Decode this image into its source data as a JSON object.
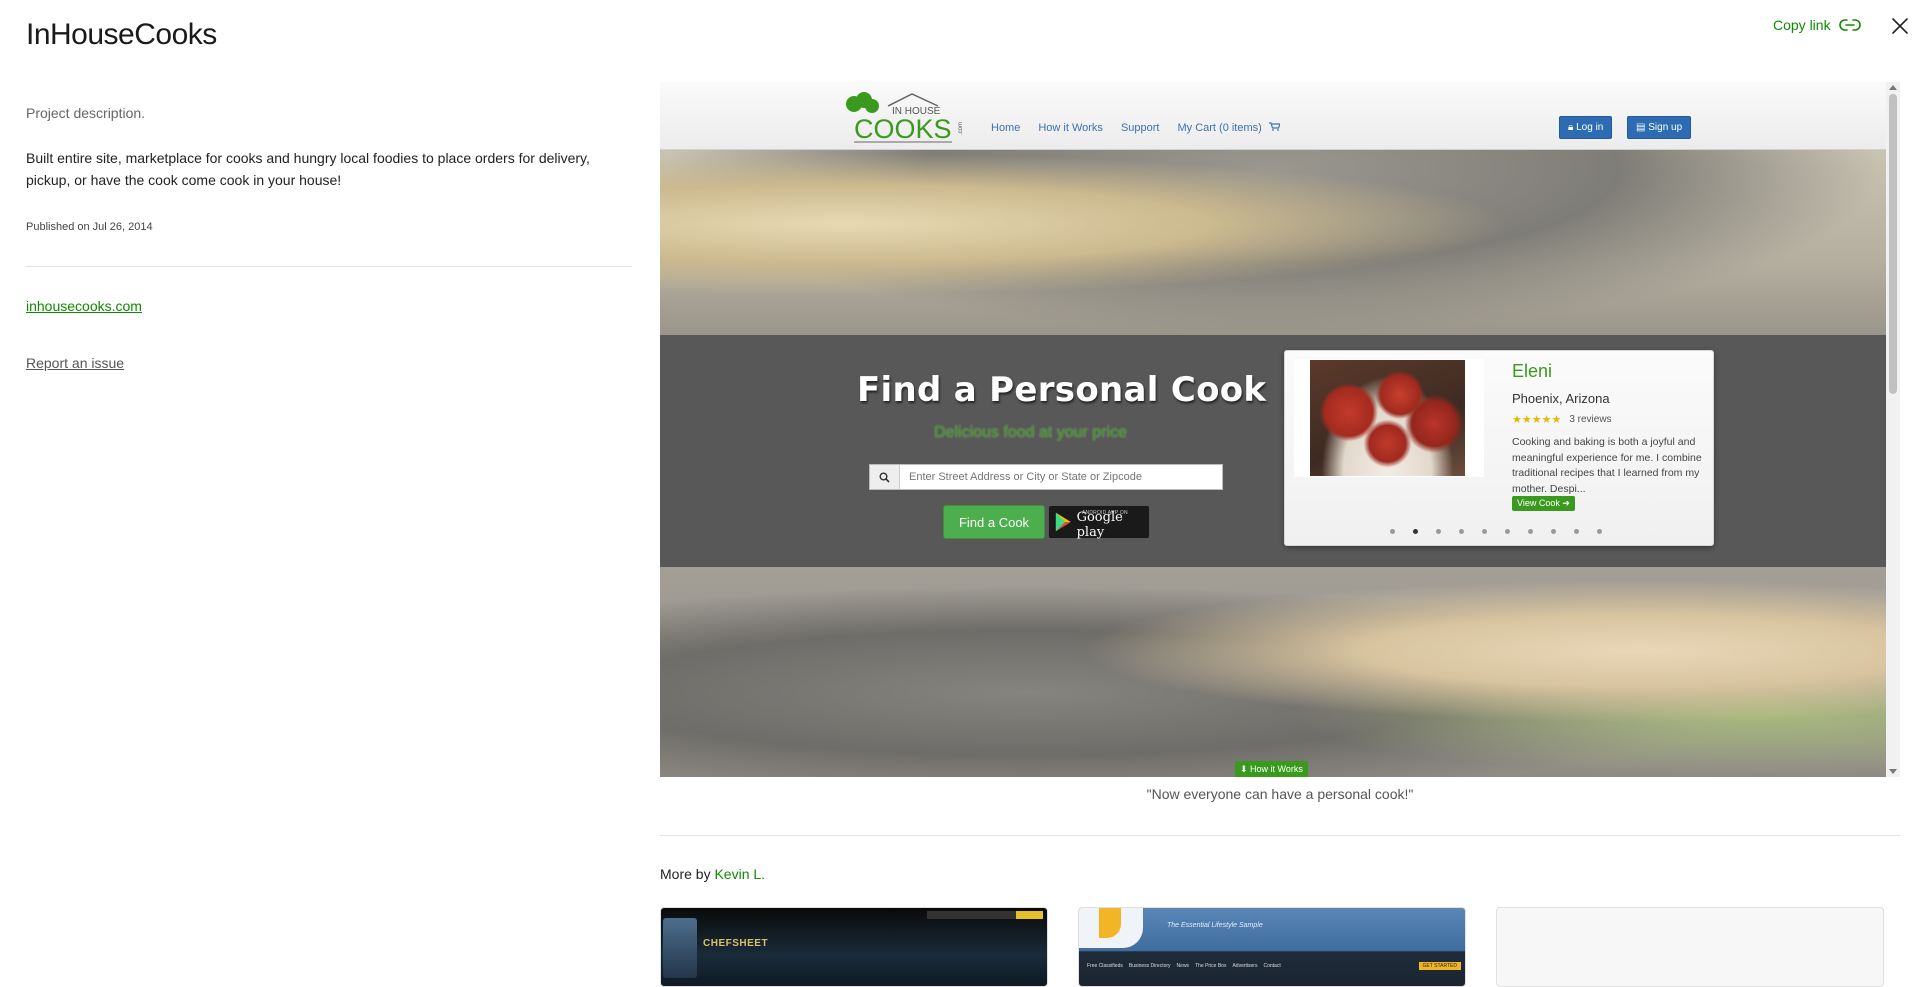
{
  "project": {
    "title": "InHouseCooks",
    "description_label": "Project description.",
    "description": "Built entire site, marketplace for cooks and hungry local foodies to place orders for delivery, pickup, or have the cook come cook in your house!",
    "published": "Published on Jul 26, 2014",
    "site_link": "inhousecooks.com",
    "report_link": "Report an issue"
  },
  "header": {
    "copy_link_label": "Copy link"
  },
  "screenshot": {
    "nav": {
      "logo_alt": "IN HOUSE COOKS .com",
      "logo_top": "IN HOUSE",
      "logo_main": "COOKS",
      "logo_suffix": ".com",
      "items": [
        "Home",
        "How it Works",
        "Support",
        "My Cart (0 items)"
      ],
      "login": "Log in",
      "signup": "Sign up"
    },
    "hero": {
      "title": "Find a Personal Cook",
      "subtitle": "Delicious food at your price",
      "search_placeholder": "Enter Street Address or City or State or Zipcode",
      "find_button": "Find a Cook",
      "gplay_small": "ANDROID APP ON",
      "gplay_text": "Google play"
    },
    "cook_card": {
      "name": "Eleni",
      "location": "Phoenix, Arizona",
      "stars": "★★★★★",
      "reviews": "3 reviews",
      "text": "Cooking and baking is both a joyful and meaningful experience for me. I combine traditional recipes that I learned from my mother. Despi...",
      "view_button": "View Cook ➔",
      "slides_total": 10,
      "slide_active": 2
    },
    "how_it_works": "⬇ How it Works"
  },
  "caption": "\"Now everyone can have a personal cook!\"",
  "more_by": {
    "prefix": "More by",
    "author": "Kevin L."
  },
  "thumbnails": [
    {
      "logo": "CHEFSHEET"
    },
    {
      "tagline": "The Essential Lifestyle Sample",
      "menu": [
        "Free Classifieds",
        "Business Directory",
        "News",
        "The Price Box",
        "Advertisers",
        "Contact"
      ],
      "cta": "GET STARTED"
    },
    {}
  ],
  "colors": {
    "accent": "#108a00",
    "site_green": "#3a9a1e",
    "site_blue": "#2d6cb3"
  }
}
